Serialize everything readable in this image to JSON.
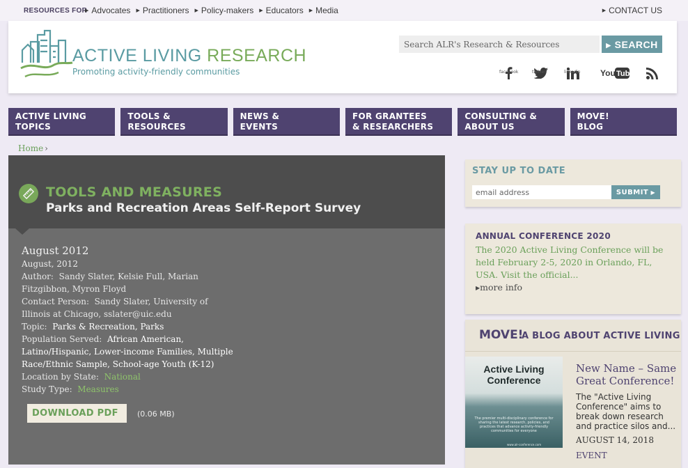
{
  "topbar": {
    "resources_label": "RESOURCES FOR",
    "links": [
      "Advocates",
      "Practitioners",
      "Policy-makers",
      "Educators",
      "Media"
    ],
    "contact": "CONTACT US"
  },
  "header": {
    "brand_part1": "ACTIVE LIVING",
    "brand_part2": "RESEARCH",
    "tagline": "Promoting activity-friendly communities",
    "search_placeholder": "Search ALR's Research & Resources",
    "search_button": "SEARCH",
    "social": [
      {
        "name": "facebook-icon",
        "label": "facebook"
      },
      {
        "name": "twitter-icon",
        "label": "twitter"
      },
      {
        "name": "linkedin-icon",
        "label": "linkedin"
      },
      {
        "name": "youtube-icon",
        "label": ""
      },
      {
        "name": "rss-icon",
        "label": ""
      }
    ]
  },
  "nav": {
    "tabs": [
      "ACTIVE LIVING\nTOPICS",
      "TOOLS &\nRESOURCES",
      "NEWS &\nEVENTS",
      "FOR GRANTEES\n& RESEARCHERS",
      "CONSULTING &\nABOUT US",
      "MOVE!\nBLOG"
    ]
  },
  "breadcrumb": {
    "home": "Home",
    "sep": "›"
  },
  "main": {
    "kicker": "TOOLS AND MEASURES",
    "title": "Parks and Recreation Areas Self-Report Survey",
    "date_heading": "August 2012",
    "date": "August, 2012",
    "author_label": "Author:",
    "author": "Sandy Slater, Kelsie Full, Marian Fitzgibbon, Myron Floyd",
    "contact_label": "Contact Person:",
    "contact": "Sandy Slater, University of Illinois at Chicago, sslater@uic.edu",
    "topic_label": "Topic:",
    "topic": "Parks & Recreation, Parks",
    "population_label": "Population Served:",
    "population": "African American, Latino/Hispanic, Lower-income Families, Multiple Race/Ethnic Sample, School-age Youth (K-12)",
    "location_label": "Location by State:",
    "location": "National",
    "study_label": "Study Type:",
    "study": "Measures",
    "download_label": "DOWNLOAD PDF",
    "download_size": "(0.06 MB)"
  },
  "sidebar": {
    "stay_title": "STAY UP TO DATE",
    "email_placeholder": "email address",
    "submit": "SUBMIT",
    "conf_title": "ANNUAL CONFERENCE 2020",
    "conf_text": "The 2020 Active Living Conference will be held February 2-5, 2020 in Orlando, FL, USA. Visit the official...",
    "conf_more": "more info",
    "blog_move": "MOVE!",
    "blog_rest": "A BLOG ABOUT ACTIVE LIVING",
    "blog_image_title": "Active Living Conference",
    "blog_image_sub": "The premier multi-disciplinary conference for sharing the latest research, policies, and practices that advance activity-friendly communities for everyone",
    "blog_image_url": "www.alr-conference.com",
    "post_title": "New Name – Same Great Conference!",
    "post_excerpt": "The \"Active Living Conference\" aims to break down research and practice silos and...",
    "post_date": "AUGUST 14, 2018",
    "post_type": "EVENT"
  },
  "colors": {
    "nav_purple": "#4f4370",
    "teal": "#6a9aa3",
    "green": "#79ab5a",
    "panel_dark": "#4d4d4d",
    "panel_body": "#6d6d6d",
    "sidebar_beige": "#ede8dc"
  }
}
